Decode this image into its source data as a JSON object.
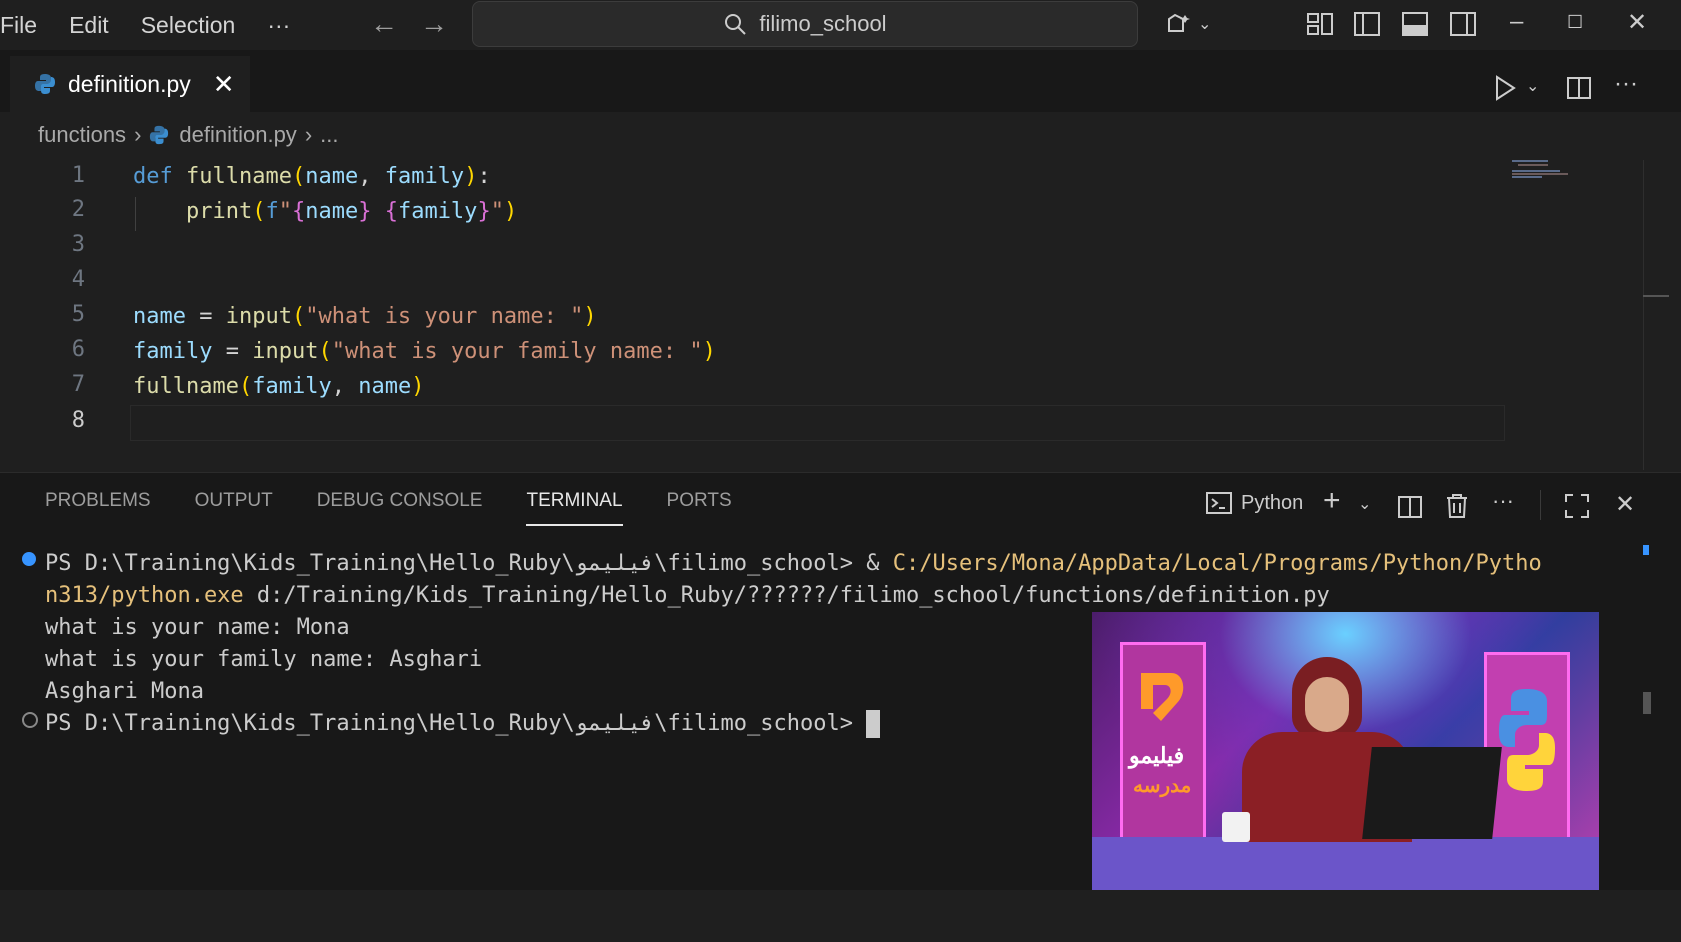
{
  "menu": {
    "file": "File",
    "edit": "Edit",
    "selection": "Selection",
    "more": "···"
  },
  "search": {
    "text": "filimo_school"
  },
  "tab": {
    "filename": "definition.py",
    "close": "✕"
  },
  "breadcrumb": {
    "folder": "functions",
    "file": "definition.py",
    "more": "..."
  },
  "editor": {
    "line_numbers": [
      "1",
      "2",
      "3",
      "4",
      "5",
      "6",
      "7",
      "8"
    ],
    "active_line": 8
  },
  "panel": {
    "tabs": [
      "PROBLEMS",
      "OUTPUT",
      "DEBUG CONSOLE",
      "TERMINAL",
      "PORTS"
    ],
    "active_tab": "TERMINAL",
    "shell": "Python"
  },
  "terminal": {
    "line1_prompt": "PS D:\\Training\\Kids_Training\\Hello_Ruby\\فیلیمو\\filimo_school> & ",
    "line1_cmd": "C:/Users/Mona/AppData/Local/Programs/Python/Pytho",
    "line2_cmd": "n313/python.exe",
    "line2_rest": " d:/Training/Kids_Training/Hello_Ruby/??????/filimo_school/functions/definition.py",
    "line3": "what is your name: Mona",
    "line4": "what is your family name: Asghari",
    "line5": "Asghari Mona",
    "line6_prompt": "PS D:\\Training\\Kids_Training\\Hello_Ruby\\فیلیمو\\filimo_school> "
  },
  "video": {
    "logo_text_1": "فیلیمو",
    "logo_text_2": "مدرسه"
  },
  "colors": {
    "background": "#1f1f1f",
    "panel": "#181818",
    "accent_blue": "#3794ff",
    "keyword": "#569cd6",
    "string": "#ce9178"
  }
}
